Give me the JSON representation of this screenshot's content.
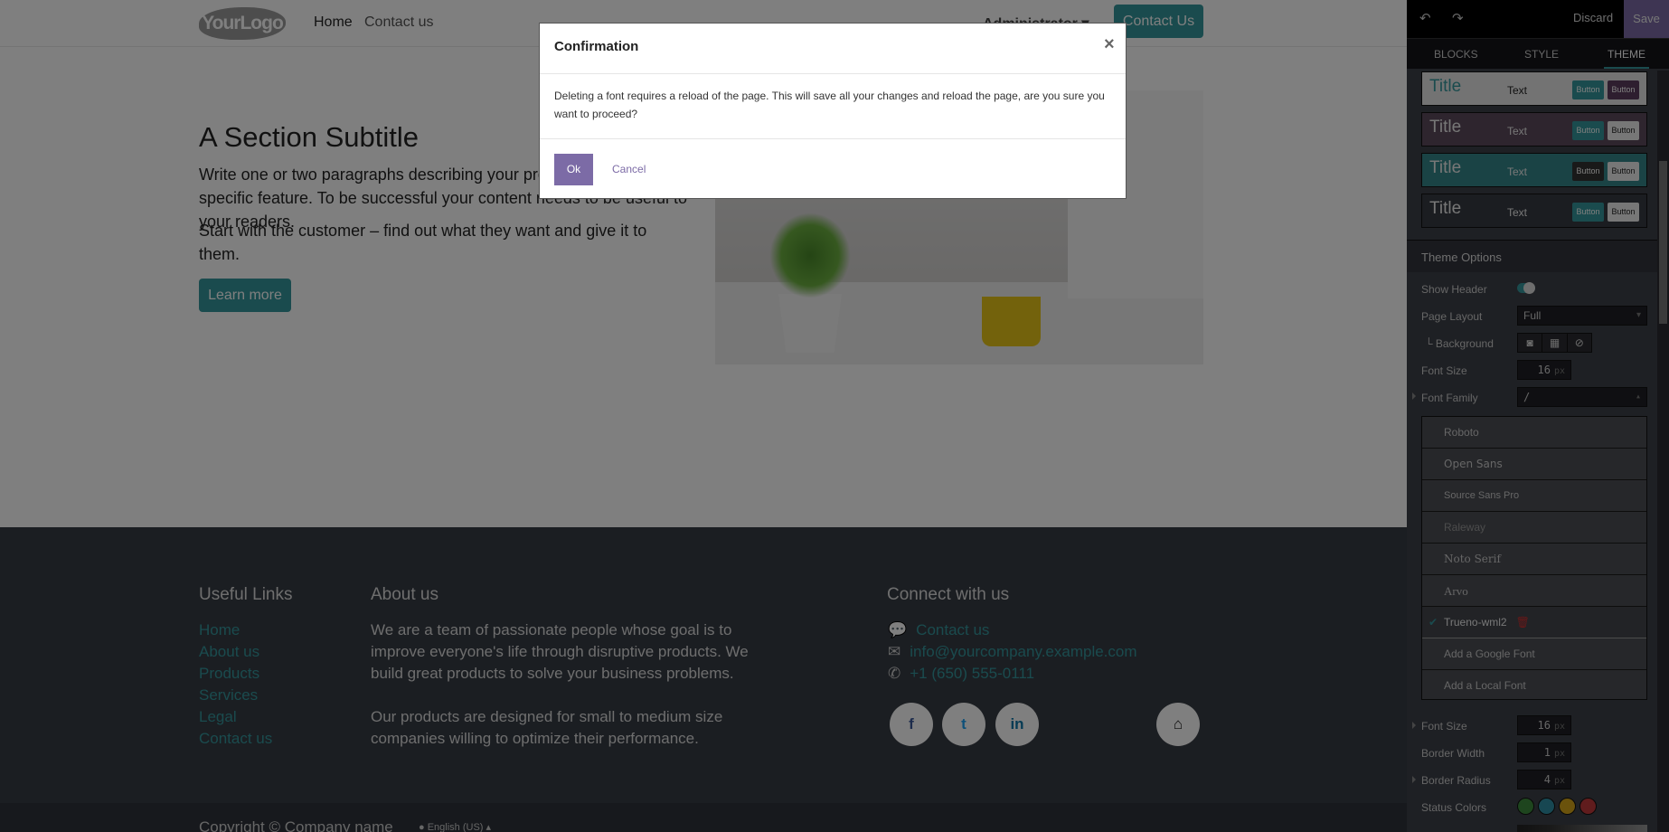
{
  "header": {
    "logo": "YourLogo",
    "nav": [
      "Home",
      "Contact us"
    ],
    "user": "Administrator",
    "cta": "Contact Us"
  },
  "content": {
    "subtitle": "A Section Subtitle",
    "para1": "Write one or two paragraphs describing your product, services or a specific feature. To be successful your content needs to be useful to your readers.",
    "para2": "Start with the customer – find out what they want and give it to them.",
    "button": "Learn more"
  },
  "footer": {
    "links_title": "Useful Links",
    "links": [
      "Home",
      "About us",
      "Products",
      "Services",
      "Legal",
      "Contact us"
    ],
    "about_title": "About us",
    "about_p1": "We are a team of passionate people whose goal is to improve everyone's life through disruptive products. We build great products to solve your business problems.",
    "about_p2": "Our products are designed for small to medium size companies willing to optimize their performance.",
    "connect_title": "Connect with us",
    "contact": "Contact us",
    "email": "info@yourcompany.example.com",
    "phone": "+1 (650) 555-0111",
    "social": [
      "facebook-icon",
      "twitter-icon",
      "linkedin-icon",
      "home-icon"
    ],
    "copyright": "Copyright © Company name",
    "language": "English (US)"
  },
  "modal": {
    "title": "Confirmation",
    "body": "Deleting a font requires a reload of the page. This will save all your changes and reload the page, are you sure you want to proceed?",
    "ok": "Ok",
    "cancel": "Cancel",
    "close": "×"
  },
  "panel": {
    "discard": "Discard",
    "save": "Save",
    "tabs": [
      "BLOCKS",
      "STYLE",
      "THEME"
    ],
    "active_tab": "THEME",
    "cards": [
      {
        "title": "Title",
        "text": "Text",
        "btn1": "Button",
        "btn2": "Button"
      },
      {
        "title": "Title",
        "text": "Text",
        "btn1": "Button",
        "btn2": "Button"
      },
      {
        "title": "Title",
        "text": "Text",
        "btn1": "Button",
        "btn2": "Button"
      },
      {
        "title": "Title",
        "text": "Text",
        "btn1": "Button",
        "btn2": "Button"
      }
    ],
    "section": "Theme Options",
    "show_header": "Show Header",
    "show_header_on": true,
    "page_layout": "Page Layout",
    "page_layout_value": "Full",
    "background": "└ Background",
    "font_size": "Font Size",
    "font_size_value": "16",
    "unit": "px",
    "font_family": "Font Family",
    "font_family_value": "/",
    "fonts": [
      "Roboto",
      "Open Sans",
      "Source Sans Pro",
      "Raleway",
      "Noto Serif",
      "Arvo",
      "Trueno-wml2"
    ],
    "selected_font": "Trueno-wml2",
    "add_google": "Add a Google Font",
    "add_local": "Add a Local Font",
    "btn_font_size": "Font Size",
    "btn_font_size_value": "16",
    "border_width": "Border Width",
    "border_width_value": "1",
    "border_radius": "Border Radius",
    "border_radius_value": "4",
    "status_colors": "Status Colors",
    "status": [
      "#3c8a3c",
      "#2f8fa4",
      "#d4a418",
      "#c0383b"
    ],
    "accent": "#35979c",
    "purple": "#7c6ba6"
  }
}
